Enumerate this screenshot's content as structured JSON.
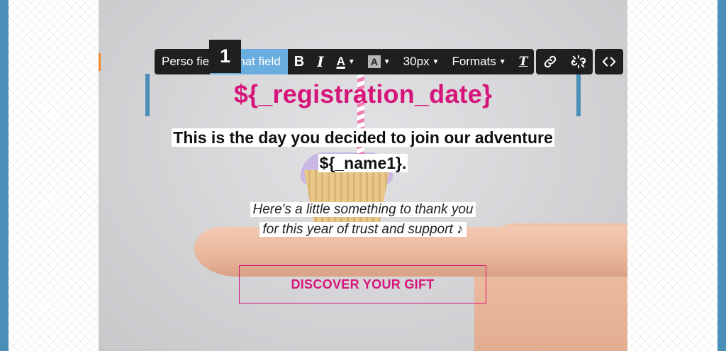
{
  "toolbar": {
    "number_badge": "1",
    "perso_field_label": "Perso field",
    "format_field_label": "Format field",
    "bold_label": "B",
    "italic_label": "I",
    "text_color_label": "A",
    "bg_color_label": "A",
    "font_size_label": "30px",
    "formats_label": "Formats",
    "clear_format_label": "T",
    "icons": [
      "link-icon",
      "unlink-icon",
      "code-icon",
      "chevron-down-icon"
    ]
  },
  "email": {
    "title_variable": "${_registration_date}",
    "headline_line1": "This is the day you decided to join our adventure",
    "headline_line2": "${_name1}.",
    "subline_line1": "Here's a little something to thank you",
    "subline_line2": "for this year of trust and support ♪",
    "cta_label": "DISCOVER YOUR GIFT"
  },
  "colors": {
    "accent": "#d6157a",
    "frame": "#4a8fb8",
    "toolbar_bg": "#1f1f1f",
    "toolbar_active": "#6aaee0"
  }
}
